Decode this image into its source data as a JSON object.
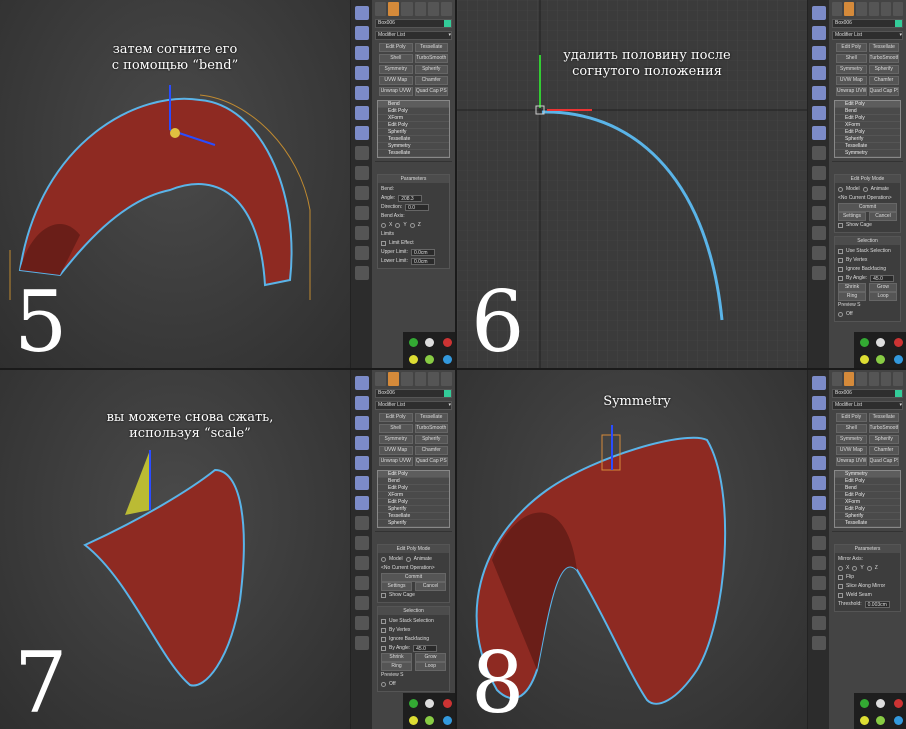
{
  "panels": [
    {
      "number": "5",
      "caption": [
        "затем согните его",
        "с помощью “bend”"
      ],
      "object_name": "Box006",
      "modifier_list": "Modifier List",
      "buttons": [
        "Edit Poly",
        "Tessellate",
        "Shell",
        "TurboSmooth",
        "Symmetry",
        "Spherify",
        "UVW Map",
        "Chamfer",
        "Unwrap UVW",
        "Quad Cap PS"
      ],
      "stack": [
        "Bend",
        "Edit Poly",
        "XForm",
        "Edit Poly",
        "Spherify",
        "Tessellate",
        "Symmetry",
        "Tessellate"
      ],
      "rollouts": [
        {
          "title": "Parameters",
          "rows": [
            {
              "label": "Bend:"
            },
            {
              "label": "Angle:",
              "value": "208.3"
            },
            {
              "label": "Direction:",
              "value": "0.0"
            },
            {
              "label": "Bend Axis:"
            },
            {
              "radios": [
                "X",
                "Y",
                "Z"
              ]
            },
            {
              "label": "Limits"
            },
            {
              "check": "Limit Effect"
            },
            {
              "label": "Upper Limit:",
              "value": "0.0cm"
            },
            {
              "label": "Lower Limit:",
              "value": "0.0cm"
            }
          ]
        }
      ]
    },
    {
      "number": "6",
      "caption": [
        "удалить половину после",
        "согнутого положения"
      ],
      "object_name": "Box006",
      "modifier_list": "Modifier List",
      "buttons": [
        "Edit Poly",
        "Tessellate",
        "Shell",
        "TurboSmooth",
        "Symmetry",
        "Spherify",
        "UVW Map",
        "Chamfer",
        "Unwrap UVW",
        "Quad Cap PS"
      ],
      "stack": [
        "Edit Poly",
        "Bend",
        "Edit Poly",
        "XForm",
        "Edit Poly",
        "Spherify",
        "Tessellate",
        "Symmetry"
      ],
      "rollouts": [
        {
          "title": "Edit Poly Mode",
          "rows": [
            {
              "radios": [
                "Model",
                "Animate"
              ]
            },
            {
              "label": "<No Current Operation>"
            },
            {
              "button": "Commit"
            },
            {
              "buttons": [
                "Settings",
                "Cancel"
              ]
            },
            {
              "check": "Show Cage"
            }
          ]
        },
        {
          "title": "Selection",
          "rows": [
            {
              "check": "Use Stack Selection"
            },
            {
              "check": "By Vertex"
            },
            {
              "check": "Ignore Backfacing"
            },
            {
              "check": "By Angle:",
              "value": "45.0"
            },
            {
              "buttons": [
                "Shrink",
                "Grow"
              ]
            },
            {
              "buttons": [
                "Ring",
                "Loop"
              ]
            },
            {
              "label": "Preview S"
            },
            {
              "radios": [
                "Off"
              ]
            }
          ]
        }
      ]
    },
    {
      "number": "7",
      "caption": [
        "вы можете снова сжать,",
        "используя “scale”"
      ],
      "object_name": "Box006",
      "modifier_list": "Modifier List",
      "buttons": [
        "Edit Poly",
        "Tessellate",
        "Shell",
        "TurboSmooth",
        "Symmetry",
        "Spherify",
        "UVW Map",
        "Chamfer",
        "Unwrap UVW",
        "Quad Cap PS"
      ],
      "stack": [
        "Edit Poly",
        "Bend",
        "Edit Poly",
        "XForm",
        "Edit Poly",
        "Spherify",
        "Tessellate",
        "Spherify"
      ],
      "rollouts": [
        {
          "title": "Edit Poly Mode",
          "rows": [
            {
              "radios": [
                "Model",
                "Animate"
              ]
            },
            {
              "label": "<No Current Operation>"
            },
            {
              "button": "Commit"
            },
            {
              "buttons": [
                "Settings",
                "Cancel"
              ]
            },
            {
              "check": "Show Cage"
            }
          ]
        },
        {
          "title": "Selection",
          "rows": [
            {
              "check": "Use Stack Selection"
            },
            {
              "check": "By Vertex"
            },
            {
              "check": "Ignore Backfacing"
            },
            {
              "check": "By Angle:",
              "value": "45.0"
            },
            {
              "buttons": [
                "Shrink",
                "Grow"
              ]
            },
            {
              "buttons": [
                "Ring",
                "Loop"
              ]
            },
            {
              "label": "Preview S"
            },
            {
              "radios": [
                "Off"
              ]
            }
          ]
        }
      ]
    },
    {
      "number": "8",
      "caption": [
        "Symmetry"
      ],
      "object_name": "Box006",
      "modifier_list": "Modifier List",
      "buttons": [
        "Edit Poly",
        "Tessellate",
        "Shell",
        "TurboSmooth",
        "Symmetry",
        "Spherify",
        "UVW Map",
        "Chamfer",
        "Unwrap UVW",
        "Quad Cap PS"
      ],
      "stack": [
        "Symmetry",
        "Edit Poly",
        "Bend",
        "Edit Poly",
        "XForm",
        "Edit Poly",
        "Spherify",
        "Tessellate"
      ],
      "rollouts": [
        {
          "title": "Parameters",
          "rows": [
            {
              "label": "Mirror Axis:"
            },
            {
              "radios": [
                "X",
                "Y",
                "Z"
              ]
            },
            {
              "check": "Flip"
            },
            {
              "check": "Slice Along Mirror"
            },
            {
              "check": "Weld Seam"
            },
            {
              "label": "Threshold:",
              "value": "0.003cm"
            }
          ]
        }
      ]
    }
  ],
  "colors": {
    "mesh": "#8e2a22",
    "outline": "#5ab4e8",
    "accent": "#d58a3a"
  }
}
